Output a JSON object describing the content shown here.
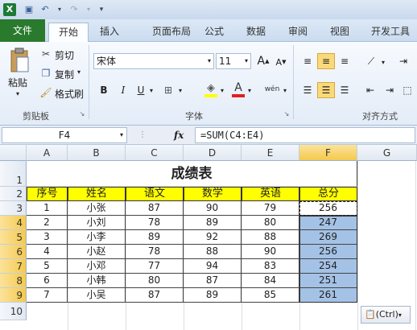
{
  "toolbar": {
    "app_icon": "excel-icon",
    "quick_access": [
      "save-icon",
      "undo-icon",
      "redo-icon",
      "customize-icon"
    ]
  },
  "tabs": [
    "文件",
    "开始",
    "插入",
    "页面布局",
    "公式",
    "数据",
    "审阅",
    "视图",
    "开发工具"
  ],
  "ribbon": {
    "paste": "粘贴",
    "cut": "剪切",
    "copy": "复制",
    "format_painter": "格式刷",
    "clipboard_group": "剪贴板",
    "font_name": "宋体",
    "font_size": "11",
    "bold": "B",
    "italic": "I",
    "underline": "U",
    "font_group": "字体",
    "phonetic": "wén",
    "align_group": "对齐方式"
  },
  "formula_bar": {
    "name_box": "F4",
    "fx": "fx",
    "formula": "=SUM(C4:E4)"
  },
  "columns": [
    "A",
    "B",
    "C",
    "D",
    "E",
    "F",
    "G"
  ],
  "rows": [
    "1",
    "2",
    "3",
    "4",
    "5",
    "6",
    "7",
    "8",
    "9",
    "10"
  ],
  "sheet": {
    "title": "成绩表",
    "headers": [
      "序号",
      "姓名",
      "语文",
      "数学",
      "英语",
      "总分"
    ],
    "data": [
      [
        "1",
        "小张",
        "87",
        "90",
        "79",
        "256"
      ],
      [
        "2",
        "小刘",
        "78",
        "89",
        "80",
        "247"
      ],
      [
        "3",
        "小李",
        "89",
        "92",
        "88",
        "269"
      ],
      [
        "4",
        "小赵",
        "78",
        "88",
        "90",
        "256"
      ],
      [
        "5",
        "小邓",
        "77",
        "94",
        "83",
        "254"
      ],
      [
        "6",
        "小韩",
        "80",
        "87",
        "84",
        "251"
      ],
      [
        "7",
        "小吴",
        "87",
        "89",
        "85",
        "261"
      ]
    ]
  },
  "paste_options": "(Ctrl)",
  "colors": {
    "file_tab": "#2a7a2e",
    "header_fill": "#ffff00",
    "selection": "#a4c2e6"
  }
}
